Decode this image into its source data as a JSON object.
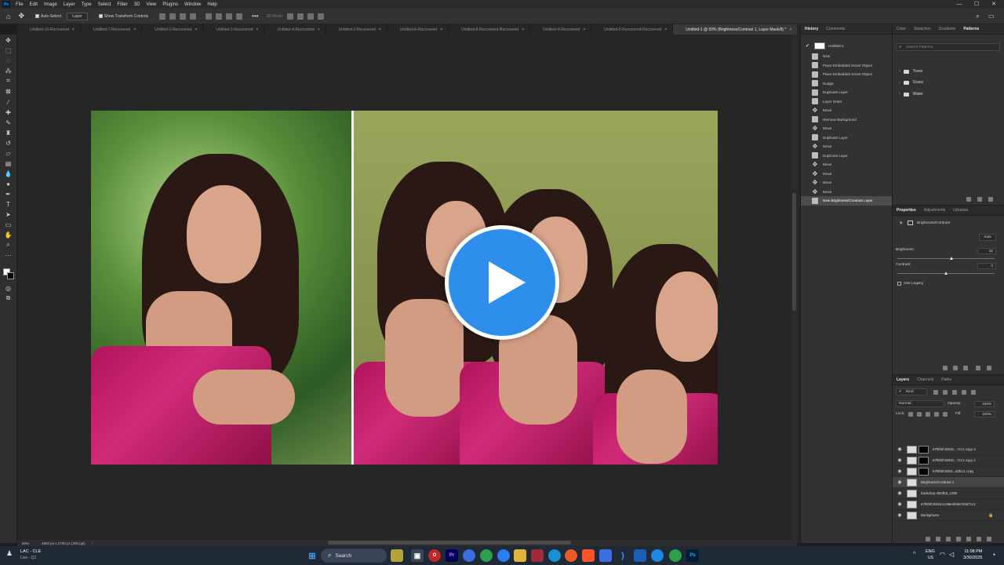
{
  "app": {
    "logo": "Ps"
  },
  "menu": [
    "File",
    "Edit",
    "Image",
    "Layer",
    "Type",
    "Select",
    "Filter",
    "3D",
    "View",
    "Plugins",
    "Window",
    "Help"
  ],
  "window_controls": [
    "—",
    "☐",
    "✕"
  ],
  "options": {
    "auto_select": "Auto-Select:",
    "target": "Layer",
    "transform": "Show Transform Controls"
  },
  "tabs": [
    "Untitled-10-Recovered",
    "Untitled-7-Recovered",
    "Untitled-2-Recovered",
    "Untitled-3-Recovered",
    "Untitled-4-Recovered",
    "Untitled-2-Recovered",
    "Untitled-6-Recovered",
    "Untitled-8-Recovered-Recovered",
    "Untitled-9-Recovered",
    "Untitled-5-Recovered-Recovered",
    "Untitled-1 @ 50% (Brightness/Contrast 1, Layer Mask/8) *"
  ],
  "status": {
    "zoom": "50%",
    "doc": "4800 px x 2700 px (300 ppi)"
  },
  "history": {
    "tabs": [
      "History",
      "Comments"
    ],
    "snapshot": "Untitled-1",
    "items": [
      {
        "icon": "doc",
        "label": "New"
      },
      {
        "icon": "doc",
        "label": "Place Embedded Smart Object"
      },
      {
        "icon": "doc",
        "label": "Place Embedded Smart Object"
      },
      {
        "icon": "doc",
        "label": "Nudge"
      },
      {
        "icon": "doc",
        "label": "Duplicate Layer"
      },
      {
        "icon": "doc",
        "label": "Layer Order"
      },
      {
        "icon": "move",
        "label": "Move"
      },
      {
        "icon": "doc",
        "label": "Remove Background"
      },
      {
        "icon": "move",
        "label": "Move"
      },
      {
        "icon": "doc",
        "label": "Duplicate Layer"
      },
      {
        "icon": "move",
        "label": "Move"
      },
      {
        "icon": "doc",
        "label": "Duplicate Layer"
      },
      {
        "icon": "move",
        "label": "Move"
      },
      {
        "icon": "move",
        "label": "Move"
      },
      {
        "icon": "move",
        "label": "Move"
      },
      {
        "icon": "move",
        "label": "Move"
      },
      {
        "icon": "doc",
        "label": "New Brightness/Contrast Layer"
      }
    ]
  },
  "patterns": {
    "tabs": [
      "Color",
      "Swatches",
      "Gradients",
      "Patterns"
    ],
    "search_placeholder": "Search Patterns",
    "groups": [
      "Trees",
      "Grass",
      "Water"
    ]
  },
  "properties": {
    "tabs": [
      "Properties",
      "Adjustments",
      "Libraries"
    ],
    "adj_name": "Brightness/Contrast",
    "auto": "Auto",
    "brightness_label": "Brightness:",
    "brightness": "32",
    "brightness_pct": 0.56,
    "contrast_label": "Contrast:",
    "contrast": "0",
    "contrast_pct": 0.5,
    "legacy": "Use Legacy"
  },
  "layers": {
    "tabs": [
      "Layers",
      "Channels",
      "Paths"
    ],
    "filter": "Kind",
    "blend": "Normal",
    "opacity_label": "Opacity:",
    "opacity": "100%",
    "lock_label": "Lock:",
    "fill_label": "Fill:",
    "fill": "100%",
    "items": [
      {
        "name": "67f6f4fc9253c...7cc1 copy 3",
        "mask": true,
        "sel": false
      },
      {
        "name": "67f6f4fc9253c...7cc1 copy 2",
        "mask": true,
        "sel": false
      },
      {
        "name": "67f6f4fc9253...d2fcc1 copy",
        "mask": true,
        "sel": false
      },
      {
        "name": "Brightness/Contrast 1",
        "mask": false,
        "sel": true
      },
      {
        "name": "backdrop-4523b8_1280",
        "mask": false,
        "sel": false
      },
      {
        "name": "67f6f4fc9253c1c96e4fe9a7d4d7cc1",
        "mask": false,
        "sel": false
      },
      {
        "name": "Background",
        "mask": false,
        "sel": false
      }
    ]
  },
  "taskbar": {
    "weather_temp": "LAC - CLE",
    "weather_sub": "Live - Q1",
    "search": "Search",
    "lang1": "ENG",
    "lang2": "US",
    "time": "11:08 PM",
    "date": "3/30/2025"
  }
}
